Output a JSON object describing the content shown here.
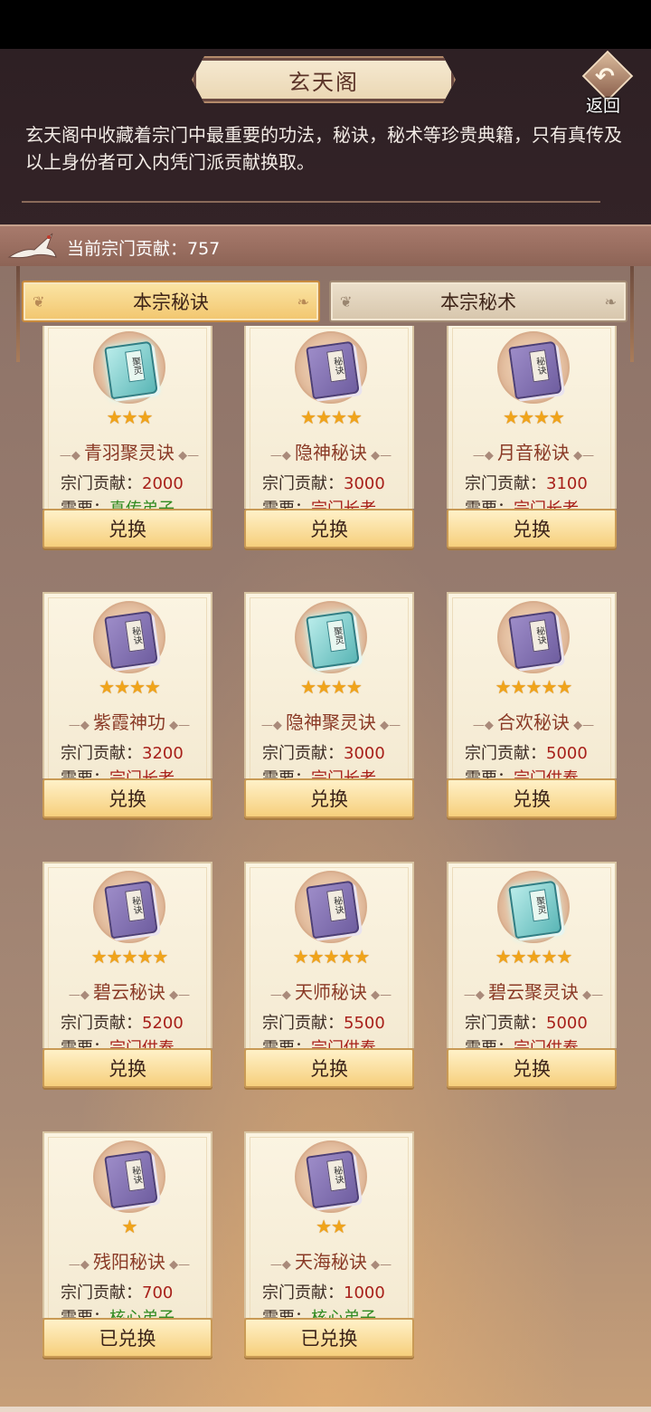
{
  "header": {
    "title": "玄天阁",
    "back_label": "返回",
    "description": "玄天阁中收藏着宗门中最重要的功法，秘诀，秘术等珍贵典籍，只有真传及以上身份者可入内凭门派贡献换取。"
  },
  "contribution": {
    "text": "当前宗门贡献：757",
    "value": 757
  },
  "tabs": [
    {
      "label": "本宗秘诀",
      "active": true
    },
    {
      "label": "本宗秘术",
      "active": false
    }
  ],
  "colors": {
    "accent_gold": "#f2c66e",
    "requirement_red": "#a8201a",
    "requirement_green": "#2f8a20",
    "name_red": "#8a3a26"
  },
  "items": [
    {
      "name": "青羽聚灵诀",
      "stars": "★★★",
      "star_count": 3,
      "cost_label": "宗门贡献：",
      "cost": "2000",
      "req_label": "需要：",
      "req": "真传弟子",
      "req_color": "green",
      "book": "teal",
      "book_tag": "聚灵",
      "button": "兑换"
    },
    {
      "name": "隐神秘诀",
      "stars": "★★★★",
      "star_count": 4,
      "cost_label": "宗门贡献：",
      "cost": "3000",
      "req_label": "需要：",
      "req": "宗门长老",
      "req_color": "red",
      "book": "purple",
      "book_tag": "秘诀",
      "button": "兑换"
    },
    {
      "name": "月音秘诀",
      "stars": "★★★★",
      "star_count": 4,
      "cost_label": "宗门贡献：",
      "cost": "3100",
      "req_label": "需要：",
      "req": "宗门长老",
      "req_color": "red",
      "book": "purple",
      "book_tag": "秘诀",
      "button": "兑换"
    },
    {
      "name": "紫霞神功",
      "stars": "★★★★",
      "star_count": 4,
      "cost_label": "宗门贡献：",
      "cost": "3200",
      "req_label": "需要：",
      "req": "宗门长老",
      "req_color": "red",
      "book": "purple",
      "book_tag": "秘诀",
      "button": "兑换"
    },
    {
      "name": "隐神聚灵诀",
      "stars": "★★★★",
      "star_count": 4,
      "cost_label": "宗门贡献：",
      "cost": "3000",
      "req_label": "需要：",
      "req": "宗门长老",
      "req_color": "red",
      "book": "teal",
      "book_tag": "聚灵",
      "button": "兑换"
    },
    {
      "name": "合欢秘诀",
      "stars": "★★★★★",
      "star_count": 5,
      "cost_label": "宗门贡献：",
      "cost": "5000",
      "req_label": "需要：",
      "req": "宗门供奉",
      "req_color": "red",
      "book": "purple",
      "book_tag": "秘诀",
      "button": "兑换"
    },
    {
      "name": "碧云秘诀",
      "stars": "★★★★★",
      "star_count": 5,
      "cost_label": "宗门贡献：",
      "cost": "5200",
      "req_label": "需要：",
      "req": "宗门供奉",
      "req_color": "red",
      "book": "purple",
      "book_tag": "秘诀",
      "button": "兑换"
    },
    {
      "name": "天师秘诀",
      "stars": "★★★★★",
      "star_count": 5,
      "cost_label": "宗门贡献：",
      "cost": "5500",
      "req_label": "需要：",
      "req": "宗门供奉",
      "req_color": "red",
      "book": "purple",
      "book_tag": "秘诀",
      "button": "兑换"
    },
    {
      "name": "碧云聚灵诀",
      "stars": "★★★★★",
      "star_count": 5,
      "cost_label": "宗门贡献：",
      "cost": "5000",
      "req_label": "需要：",
      "req": "宗门供奉",
      "req_color": "red",
      "book": "teal",
      "book_tag": "聚灵",
      "button": "兑换"
    },
    {
      "name": "残阳秘诀",
      "stars": "★",
      "star_count": 1,
      "cost_label": "宗门贡献：",
      "cost": "700",
      "req_label": "需要：",
      "req": "核心弟子",
      "req_color": "green",
      "book": "purple",
      "book_tag": "秘诀",
      "button": "已兑换"
    },
    {
      "name": "天海秘诀",
      "stars": "★★",
      "star_count": 2,
      "cost_label": "宗门贡献：",
      "cost": "1000",
      "req_label": "需要：",
      "req": "核心弟子",
      "req_color": "green",
      "book": "purple",
      "book_tag": "秘诀",
      "button": "已兑换"
    }
  ]
}
